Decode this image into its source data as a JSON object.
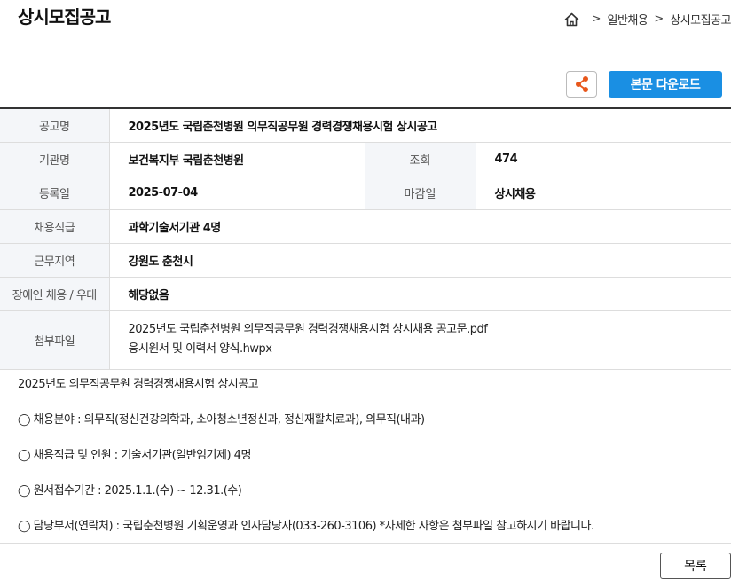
{
  "page": {
    "title": "상시모집공고"
  },
  "breadcrumb": {
    "home_icon": "home-icon",
    "items": [
      "일반채용",
      "상시모집공고"
    ],
    "separator": ">"
  },
  "actions": {
    "share_icon": "share-icon",
    "download_label": "본문 다운로드"
  },
  "info": {
    "title_label": "공고명",
    "title_value": "2025년도 국립춘천병원 의무직공무원 경력경쟁채용시험 상시공고",
    "org_label": "기관명",
    "org_value": "보건복지부 국립춘천병원",
    "views_label": "조회",
    "views_value": "474",
    "reg_label": "등록일",
    "reg_value": "2025-07-04",
    "deadline_label": "마감일",
    "deadline_value": "상시채용",
    "grade_label": "채용직급",
    "grade_value": "과학기술서기관 4명",
    "region_label": "근무지역",
    "region_value": "강원도 춘천시",
    "disability_label": "장애인 채용 / 우대",
    "disability_value": "해당없음",
    "files_label": "첨부파일",
    "files": [
      "2025년도 국립춘천병원 의무직공무원 경력경쟁채용시험 상시채용 공고문.pdf",
      "응시원서 및 이력서 양식.hwpx"
    ]
  },
  "body": {
    "lines": [
      "2025년도 의무직공무원 경력경쟁채용시험 상시공고",
      "◯ 채용분야 : 의무직(정신건강의학과, 소아청소년정신과, 정신재활치료과), 의무직(내과)",
      "◯ 채용직급 및 인원 : 기술서기관(일반임기제) 4명",
      "◯ 원서접수기간 : 2025.1.1.(수) ~ 12.31.(수)",
      "◯ 담당부서(연락처) : 국립춘천병원 기획운영과 인사담당자(033-260-3106) *자세한 사항은 첨부파일 참고하시기 바랍니다."
    ]
  },
  "footer": {
    "list_label": "목록"
  },
  "colors": {
    "accent": "#1a8fe3",
    "share_icon": "#e8571b",
    "header_bg": "#f4f6f9"
  }
}
